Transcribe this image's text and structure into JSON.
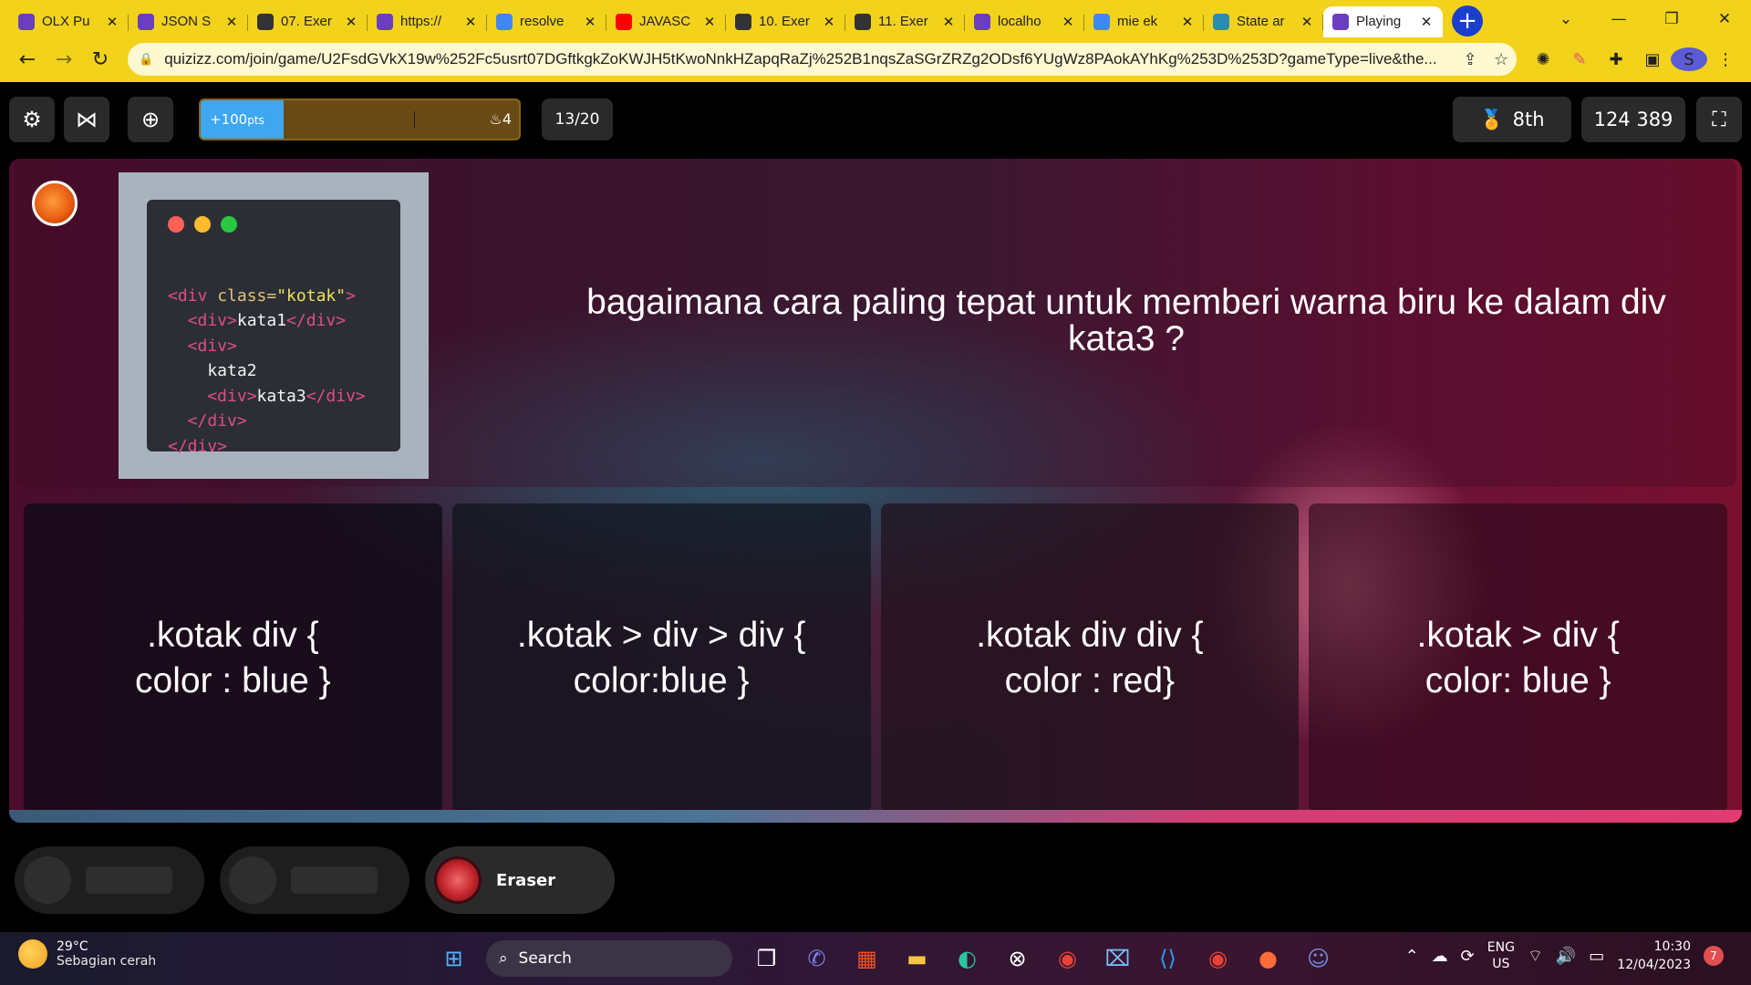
{
  "browser": {
    "tabs": [
      {
        "label": "OLX Pu",
        "icon": "quizizz-icon",
        "color": "#6a3fbf"
      },
      {
        "label": "JSON S",
        "icon": "quizizz-icon",
        "color": "#6a3fbf"
      },
      {
        "label": "07. Exer",
        "icon": "globe-icon",
        "color": "#333333"
      },
      {
        "label": "https://",
        "icon": "quizizz-icon",
        "color": "#6a3fbf"
      },
      {
        "label": "resolve",
        "icon": "google-icon",
        "color": "#4285f4"
      },
      {
        "label": "JAVASC",
        "icon": "youtube-icon",
        "color": "#ff0000"
      },
      {
        "label": "10. Exer",
        "icon": "globe-icon",
        "color": "#333333"
      },
      {
        "label": "11. Exer",
        "icon": "globe-icon",
        "color": "#333333"
      },
      {
        "label": "localho",
        "icon": "quizizz-icon",
        "color": "#6a3fbf"
      },
      {
        "label": "mie ek",
        "icon": "google-icon",
        "color": "#4285f4"
      },
      {
        "label": "State ar",
        "icon": "react-icon",
        "color": "#2a8ab0"
      },
      {
        "label": "Playing",
        "icon": "quizizz-icon",
        "color": "#6a3fbf",
        "active": true
      }
    ],
    "url": "quizizz.com/join/game/U2FsdGVkX19w%252Fc5usrt07DGftkgkZoKWJH5tKwoNnkHZapqRaZj%252B1nqsZaSGrZRZg2ODsf6YUgWz8PAokAYhKg%253D%253D?gameType=live&the...",
    "profile_initial": "S"
  },
  "quiz": {
    "bonus_label": "+100",
    "bonus_unit": "pts",
    "timer_fraction": 0.26,
    "streak": "4",
    "question_count": "13/20",
    "rank": "8th",
    "score": "124 389",
    "question": "bagaimana cara paling tepat untuk memberi warna biru ke dalam div kata3 ?",
    "code_lines": [
      [
        "<div ",
        "class=",
        "\"kotak\"",
        ">"
      ],
      [
        "  <div>",
        "kata1",
        "</div>"
      ],
      [
        "  <div>"
      ],
      [
        "    kata2"
      ],
      [
        "    <div>",
        "kata3",
        "</div>"
      ],
      [
        "  </div>"
      ],
      [
        "</div>"
      ]
    ],
    "answers": [
      {
        "line1": ".kotak div {",
        "line2": "color : blue }"
      },
      {
        "line1": ".kotak > div > div {",
        "line2": "color:blue }"
      },
      {
        "line1": ".kotak div div {",
        "line2": "color : red}"
      },
      {
        "line1": ".kotak > div {",
        "line2": "color: blue }"
      }
    ],
    "powerups": [
      {
        "label": ""
      },
      {
        "label": ""
      },
      {
        "label": "Eraser"
      }
    ]
  },
  "taskbar": {
    "temperature": "29°C",
    "weather": "Sebagian cerah",
    "search_label": "Search",
    "lang_line1": "ENG",
    "lang_line2": "US",
    "time": "10:30",
    "date": "12/04/2023",
    "notifications": "7"
  },
  "colors": {
    "chrome_yellow": "#f2d21b",
    "timer_blue": "#3fa6f0",
    "code_tag": "#e24a8a",
    "code_string": "#f0e060"
  }
}
